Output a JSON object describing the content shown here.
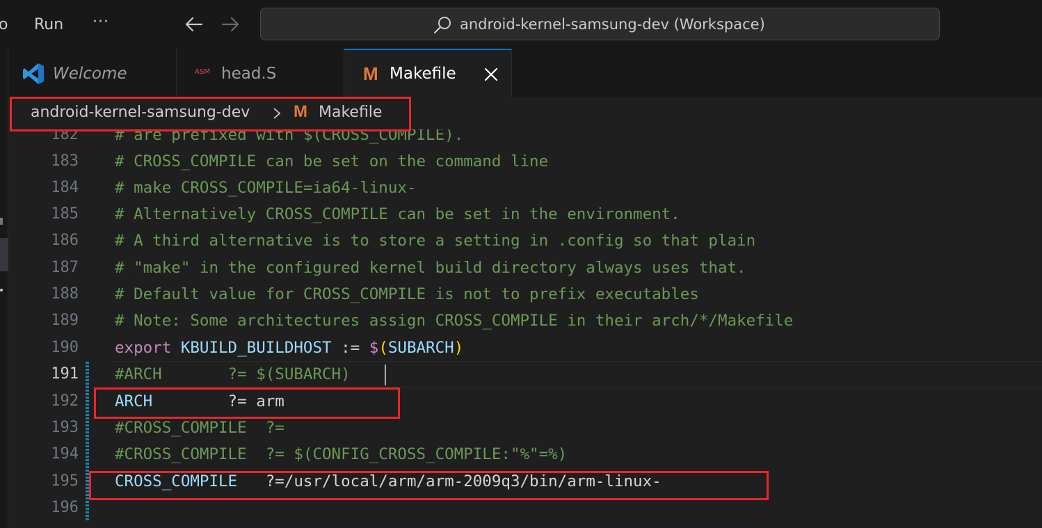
{
  "titlebar": {
    "menu_o": "o",
    "menu_run": "Run",
    "menu_more": "···",
    "command_center_text": "android-kernel-samsung-dev (Workspace)"
  },
  "tabs": [
    {
      "label": "Welcome",
      "icon": "vscode-icon"
    },
    {
      "label": "head.S",
      "icon": "asm-icon",
      "icon_text": "ASM"
    },
    {
      "label": "Makefile",
      "icon": "makefile-icon",
      "icon_text": "M",
      "active": true
    }
  ],
  "breadcrumb": {
    "folder": "android-kernel-samsung-dev",
    "file_icon_text": "M",
    "file": "Makefile"
  },
  "editor": {
    "active_line": 191,
    "lines": [
      {
        "n": "182",
        "text": "# are prefixed with $(CROSS_COMPILE)."
      },
      {
        "n": "183",
        "text": "# CROSS_COMPILE can be set on the command line"
      },
      {
        "n": "184",
        "text": "# make CROSS_COMPILE=ia64-linux-"
      },
      {
        "n": "185",
        "text": "# Alternatively CROSS_COMPILE can be set in the environment."
      },
      {
        "n": "186",
        "text": "# A third alternative is to store a setting in .config so that plain"
      },
      {
        "n": "187",
        "text": "# \"make\" in the configured kernel build directory always uses that."
      },
      {
        "n": "188",
        "text": "# Default value for CROSS_COMPILE is not to prefix executables"
      },
      {
        "n": "189",
        "text": "# Note: Some architectures assign CROSS_COMPILE in their arch/*/Makefile"
      },
      {
        "n": "190",
        "kw": "export",
        "var": "KBUILD_BUILDHOST",
        "op": ":=",
        "dollar": "$",
        "lparen": "(",
        "subarch": "SUBARCH",
        "rparen": ")"
      },
      {
        "n": "191",
        "text": "#ARCH       ?= $(SUBARCH)"
      },
      {
        "n": "192",
        "var": "ARCH",
        "rest": "        ?= arm"
      },
      {
        "n": "193",
        "text": "#CROSS_COMPILE  ?="
      },
      {
        "n": "194",
        "text": "#CROSS_COMPILE  ?= $(CONFIG_CROSS_COMPILE:\"%\"=%)"
      },
      {
        "n": "195",
        "var": "CROSS_COMPILE",
        "rest": "   ?=/usr/local/arm/arm-2009q3/bin/arm-linux-"
      },
      {
        "n": "196",
        "text": ""
      }
    ]
  },
  "colors": {
    "comment": "#6a9955",
    "keyword": "#c586c0",
    "variable": "#9cdcfe",
    "highlight_box": "#e8262b",
    "makefile_icon": "#e37933"
  }
}
